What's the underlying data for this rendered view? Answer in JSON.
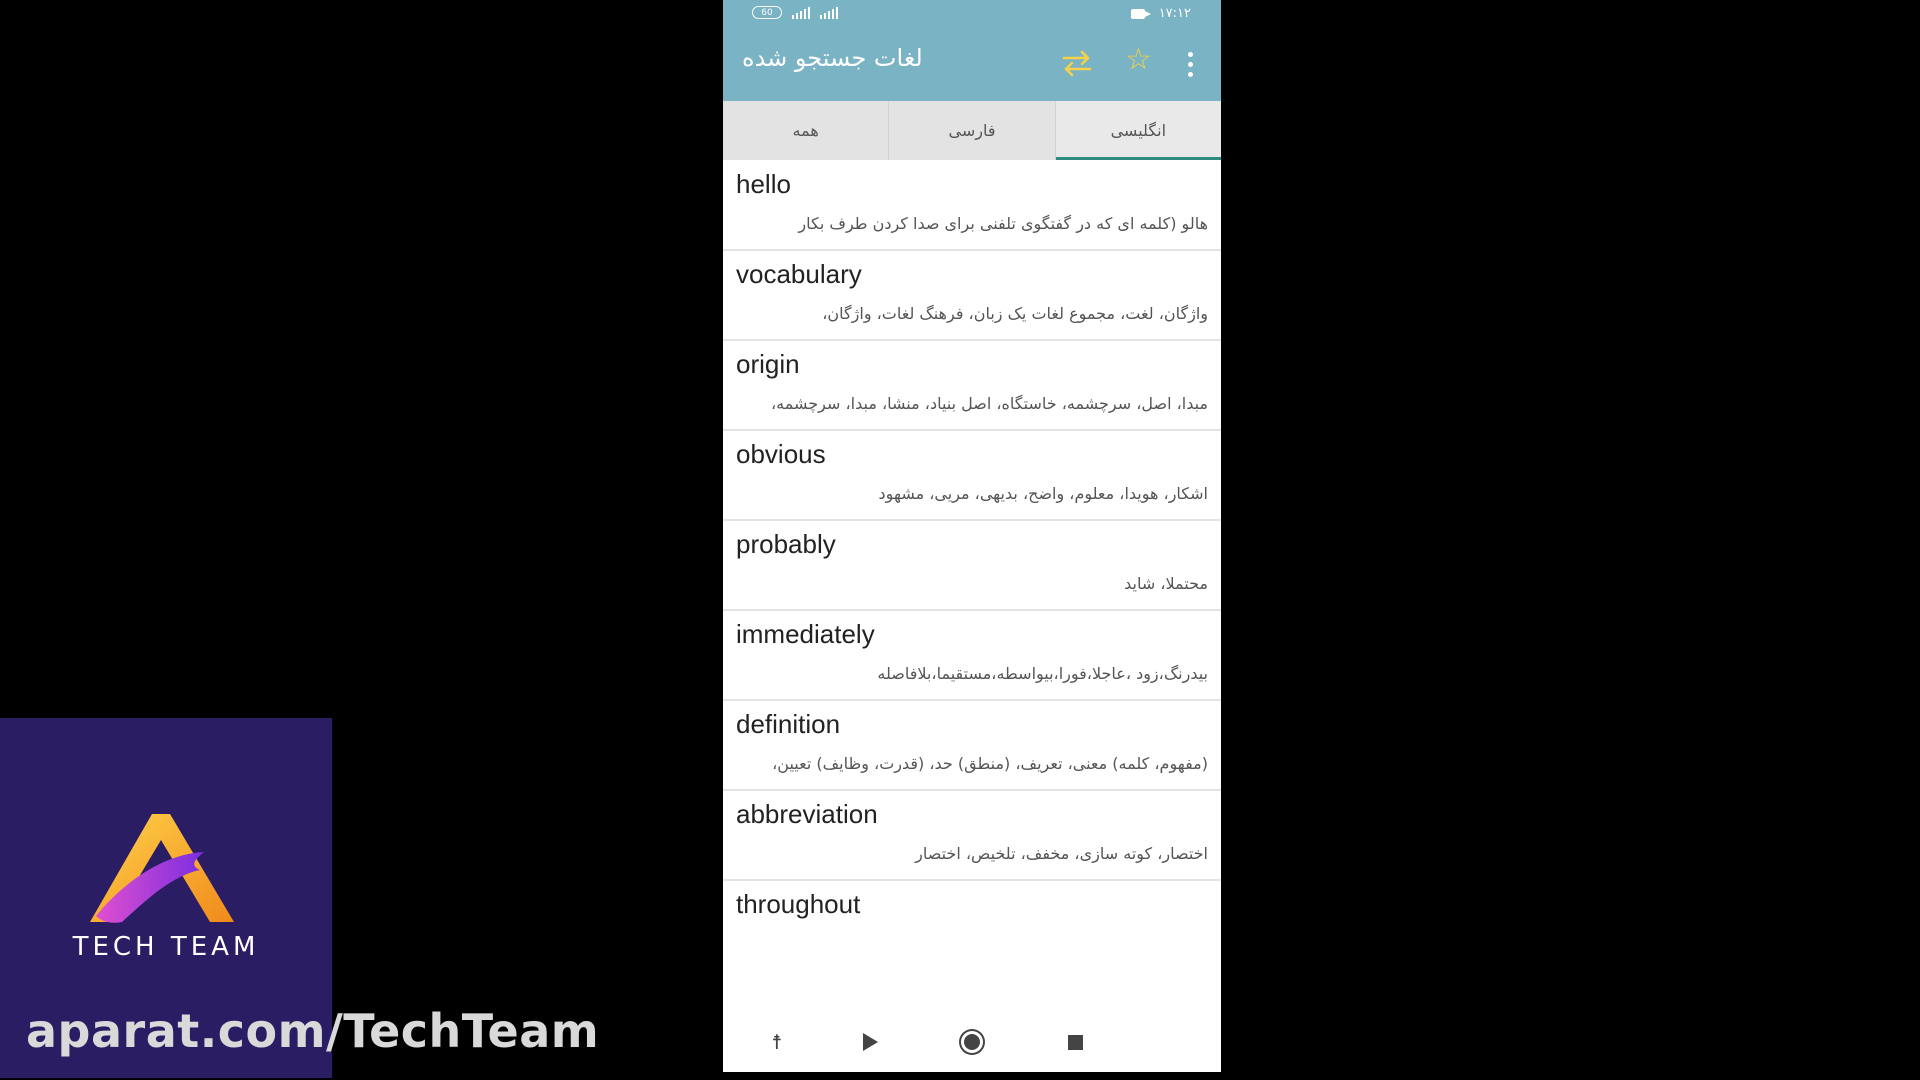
{
  "status_bar": {
    "battery": "60",
    "clock": "۱۷:۱۲"
  },
  "app_bar": {
    "title": "لغات جستجو شده"
  },
  "tabs": [
    {
      "label": "همه"
    },
    {
      "label": "فارسی"
    },
    {
      "label": "انگلیسی",
      "active": true
    }
  ],
  "entries": [
    {
      "word": "hello",
      "meaning": "هالو (کلمه ای که در گفتگوی تلفنی برای صدا کردن طرف بکار"
    },
    {
      "word": "vocabulary",
      "meaning": "واژگان، لغت، مجموع لغات یک زبان، فرهنگ لغات، واژگان،"
    },
    {
      "word": "origin",
      "meaning": "مبدا، اصل، سرچشمه، خاستگاه، اصل بنیاد، منشا، مبدا، سرچشمه،"
    },
    {
      "word": "obvious",
      "meaning": "اشکار، هویدا، معلوم، واضح، بدیهی، مریی، مشهود"
    },
    {
      "word": "probably",
      "meaning": "محتملا، شاید"
    },
    {
      "word": "immediately",
      "meaning": "بیدرنگ،زود ،عاجلا،فورا،بیواسطه،مستقیما،بلافاصله"
    },
    {
      "word": "definition",
      "meaning": "(مفهوم، کلمه) معنی، تعریف، (منطق) حد، (قدرت، وظایف) تعیین،"
    },
    {
      "word": "abbreviation",
      "meaning": "اختصار، کوته سازی، مخفف، تلخیص، اختصار"
    },
    {
      "word": "throughout",
      "meaning": ""
    }
  ],
  "watermark": {
    "logo_text": "TECH TEAM",
    "channel": "aparat.com/TechTeam"
  },
  "colors": {
    "app_bar": "#7ab3c3",
    "accent": "#f5d24a",
    "tab_indicator": "#2e8b7e",
    "logo_bg": "#2b1d63"
  }
}
